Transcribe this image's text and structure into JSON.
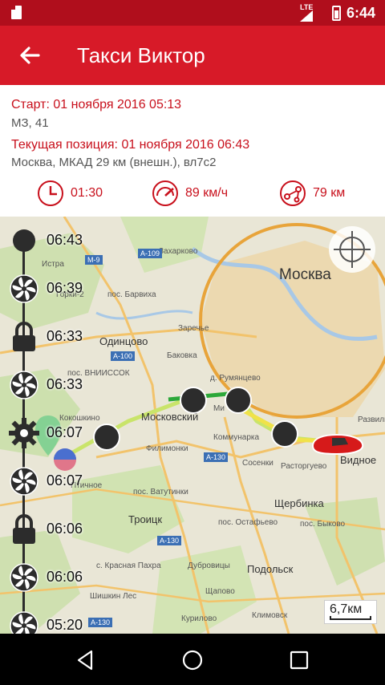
{
  "status_bar": {
    "network": "LTE",
    "time": "6:44"
  },
  "app_bar": {
    "title": "Такси Виктор"
  },
  "trip": {
    "start_label": "Старт: 01 ноября 2016  05:13",
    "start_address": "МЗ, 41",
    "current_label": "Текущая позиция: 01 ноября 2016  06:43",
    "current_address": "Москва, МКАД 29 км (внешн.), вл7с2"
  },
  "stats": {
    "duration": "01:30",
    "speed": "89 км/ч",
    "distance": "79 км"
  },
  "timeline": [
    {
      "time": "06:43",
      "icon": "start-dot-icon"
    },
    {
      "time": "06:39",
      "icon": "fan-icon"
    },
    {
      "time": "06:33",
      "icon": "lock-icon"
    },
    {
      "time": "06:33",
      "icon": "fan-icon"
    },
    {
      "time": "06:07",
      "icon": "gear-icon"
    },
    {
      "time": "06:07",
      "icon": "fan-icon"
    },
    {
      "time": "06:06",
      "icon": "lock-icon"
    },
    {
      "time": "06:06",
      "icon": "fan-icon"
    },
    {
      "time": "05:20",
      "icon": "fan-icon"
    }
  ],
  "map": {
    "city_label": "Москва",
    "scale_label": "6,7км",
    "labels": {
      "zakharkovo": "Захарково",
      "barvikha": "пос. Барвиха",
      "gorki2": "Горки-2",
      "istra": "Истра",
      "odintsovo": "Одинцово",
      "zarechye": "Заречье",
      "bakovka": "Баковка",
      "vniissok": "пос. ВНИИССОК",
      "rumyantsevo": "д. Румянцево",
      "moskovsky": "Московский",
      "kokoshkino": "Кокошкино",
      "kommunarka": "Коммунарка",
      "filimonki": "Филимонки",
      "sosenki": "Сосенки",
      "rastorguevo": "Расторгуево",
      "vidnoe": "Видное",
      "razvilka": "Развилка",
      "ptichnoe": "Птичное",
      "vatutinki": "пос. Ватутинки",
      "shcherbinka": "Щербинка",
      "troitsk": "Троицк",
      "ostafyevo": "пос. Остафьево",
      "bykovo": "пос. Быково",
      "krasnaya_pakhra": "с. Красная Пахра",
      "dubrovitsy": "Дубровицы",
      "podolsk": "Подольск",
      "shishkin_les": "Шишкин Лес",
      "shchapovo": "Щапово",
      "kurilovo": "Курилово",
      "klimovsk": "Климовск",
      "m": "Ми"
    },
    "road_tags": [
      "А-109",
      "М-9",
      "А-100",
      "А-130",
      "А-130",
      "А-130"
    ]
  }
}
